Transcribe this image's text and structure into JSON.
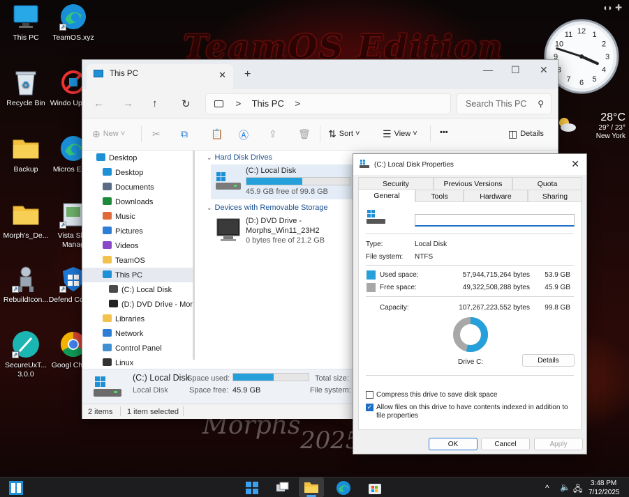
{
  "desktop": {
    "wallpaper_title": "TeamOS Edition",
    "wallpaper_sub": "Morphs",
    "wallpaper_year": "2025",
    "icons": [
      {
        "label": "This PC"
      },
      {
        "label": "TeamOS.xyz"
      },
      {
        "label": "Recycle Bin"
      },
      {
        "label": "Windo Update"
      },
      {
        "label": "Backup"
      },
      {
        "label": "Micros Edge"
      },
      {
        "label": "Morph's_De..."
      },
      {
        "label": "Vista Sho Manag"
      },
      {
        "label": "RebuildIcon..."
      },
      {
        "label": "Defend Control"
      },
      {
        "label": "SecureUxT... 3.0.0"
      },
      {
        "label": "Googl Chrom"
      }
    ]
  },
  "clock": {
    "numbers": [
      "12",
      "1",
      "2",
      "3",
      "4",
      "5",
      "6",
      "7",
      "8",
      "9",
      "10",
      "11"
    ],
    "hour": 3,
    "minute": 48
  },
  "weather": {
    "temp": "28°C",
    "range": "29° / 23°",
    "city": "New York"
  },
  "explorer": {
    "tab_title": "This PC",
    "tab_close": "✕",
    "new_tab": "+",
    "window_controls": {
      "minimize": "—",
      "maximize": "☐",
      "close": "✕"
    },
    "address": {
      "root_sep": ">",
      "location": "This PC",
      "trail_sep": ">"
    },
    "search_placeholder": "Search This PC",
    "toolbar": {
      "new": "New",
      "sort": "Sort",
      "view": "View",
      "more": "•••",
      "details": "Details"
    },
    "nav": [
      {
        "label": "Desktop",
        "icon": "desktop-icon",
        "indent": 0,
        "color": "#1e90d6"
      },
      {
        "label": "Desktop",
        "icon": "desktop-icon",
        "indent": 1,
        "color": "#1e90d6"
      },
      {
        "label": "Documents",
        "icon": "documents-icon",
        "indent": 1,
        "color": "#5a6c85"
      },
      {
        "label": "Downloads",
        "icon": "downloads-icon",
        "indent": 1,
        "color": "#1d8a3b"
      },
      {
        "label": "Music",
        "icon": "music-icon",
        "indent": 1,
        "color": "#e06a3a"
      },
      {
        "label": "Pictures",
        "icon": "pictures-icon",
        "indent": 1,
        "color": "#2e7ed6"
      },
      {
        "label": "Videos",
        "icon": "videos-icon",
        "indent": 1,
        "color": "#8a47c6"
      },
      {
        "label": "TeamOS",
        "icon": "folder-icon",
        "indent": 1,
        "color": "#f2c14e"
      },
      {
        "label": "This PC",
        "icon": "this-pc-icon",
        "indent": 1,
        "color": "#1e90d6"
      },
      {
        "label": "(C:) Local Disk",
        "icon": "drive-icon",
        "indent": 2,
        "color": "#4a4a4a"
      },
      {
        "label": "(D:) DVD Drive - Morp",
        "icon": "dvd-icon",
        "indent": 2,
        "color": "#222222"
      },
      {
        "label": "Libraries",
        "icon": "libraries-icon",
        "indent": 1,
        "color": "#f2c14e"
      },
      {
        "label": "Network",
        "icon": "network-icon",
        "indent": 1,
        "color": "#2e7ed6"
      },
      {
        "label": "Control Panel",
        "icon": "control-panel-icon",
        "indent": 1,
        "color": "#3f8fd2"
      },
      {
        "label": "Linux",
        "icon": "linux-icon",
        "indent": 1,
        "color": "#333333"
      }
    ],
    "groups": {
      "hdd": "Hard Disk Drives",
      "removable": "Devices with Removable Storage"
    },
    "drives": {
      "c": {
        "name": "(C:) Local Disk",
        "free": "45.9 GB free of 99.8 GB",
        "used_fraction": 0.54
      },
      "d": {
        "name": "(D:) DVD Drive -",
        "name2": "Morphs_Win11_23H2",
        "free": "0 bytes free of 21.2 GB"
      }
    },
    "details_pane": {
      "name": "(C:) Local Disk",
      "type": "Local Disk",
      "space_used_label": "Space used:",
      "space_free_label": "Space free:",
      "space_free": "45.9 GB",
      "total_size_label": "Total size:",
      "file_system_label": "File system:",
      "used_fraction": 0.54
    },
    "status": {
      "items": "2 items",
      "selected": "1 item selected"
    }
  },
  "properties": {
    "title": "(C:) Local Disk Properties",
    "close": "✕",
    "tabs_row1": [
      "Security",
      "Previous Versions",
      "Quota"
    ],
    "tabs_row2": [
      "General",
      "Tools",
      "Hardware",
      "Sharing"
    ],
    "name_value": "",
    "type_label": "Type:",
    "type_value": "Local Disk",
    "fs_label": "File system:",
    "fs_value": "NTFS",
    "used_label": "Used space:",
    "used_bytes": "57,944,715,264 bytes",
    "used_gb": "53.9 GB",
    "free_label": "Free space:",
    "free_bytes": "49,322,508,288 bytes",
    "free_gb": "45.9 GB",
    "capacity_label": "Capacity:",
    "capacity_bytes": "107,267,223,552 bytes",
    "capacity_gb": "99.8 GB",
    "used_fraction": 0.54,
    "drive_label": "Drive C:",
    "details_btn": "Details",
    "compress_label": "Compress this drive to save disk space",
    "compress_checked": false,
    "index_label": "Allow files on this drive to have contents indexed in addition to file properties",
    "index_checked": true,
    "ok": "OK",
    "cancel": "Cancel",
    "apply": "Apply",
    "colors": {
      "used": "#26a0da",
      "free": "#a8a8a8"
    }
  },
  "taskbar": {
    "time": "3:48 PM",
    "date": "7/12/2025",
    "tray_chevron": "^"
  }
}
